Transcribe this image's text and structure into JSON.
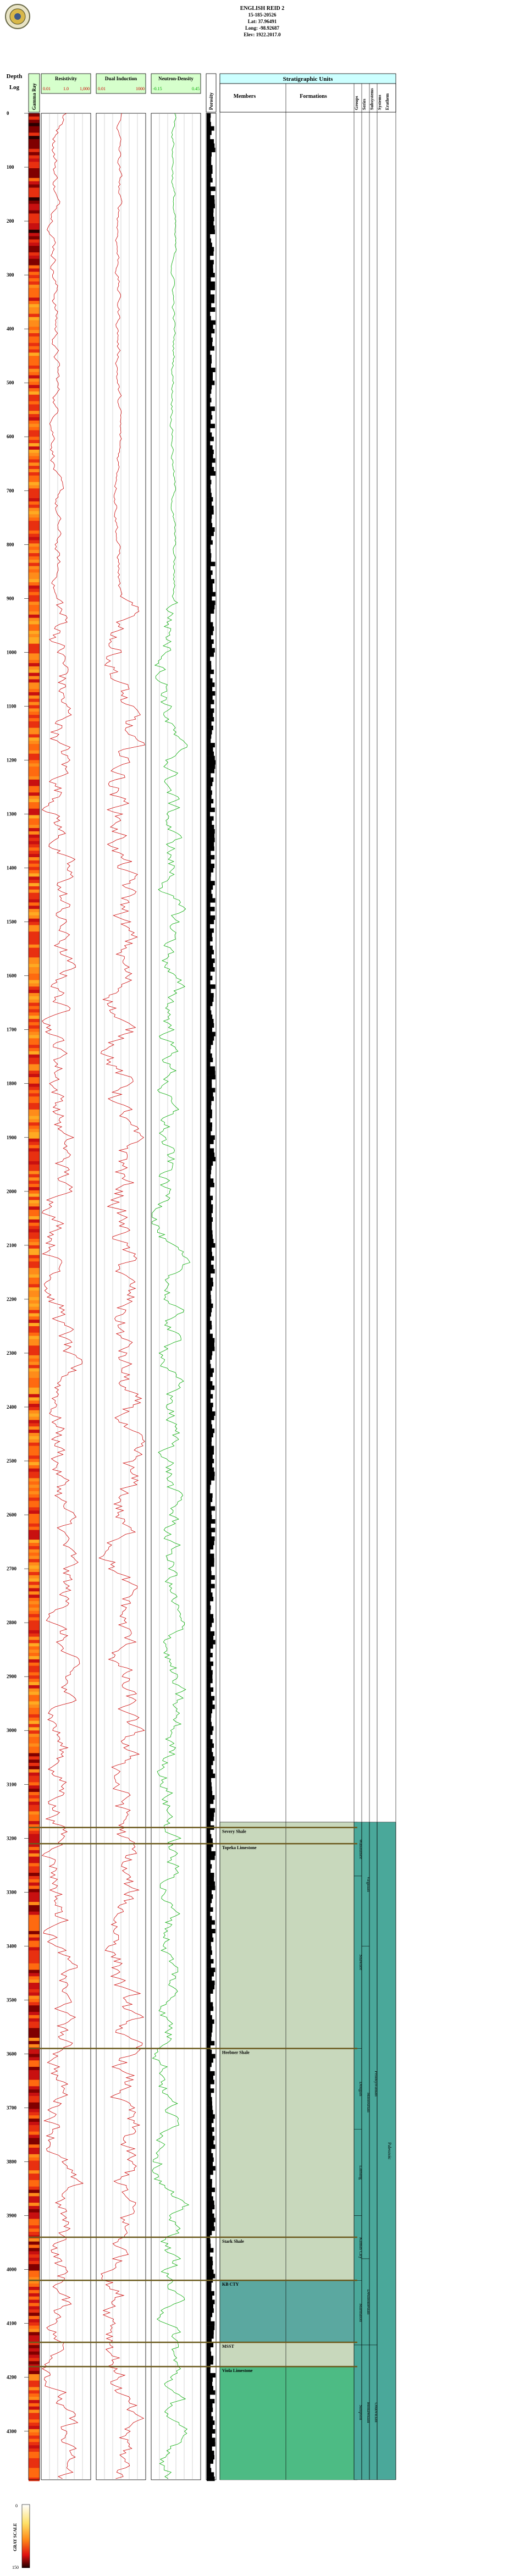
{
  "header": {
    "well_name": "ENGLISH REID 2",
    "api": "15-185-20526",
    "lat": "Lat: 37.96491",
    "long": "Long: -98.92687",
    "elev": "Elev: 1922.2017.0"
  },
  "columns": {
    "depth_title": "Depth",
    "log_title": "Log",
    "gamma_label": "Gamma Ray",
    "gamma_min": "0",
    "gamma_max": "150",
    "resistivity_label": "Resistivity",
    "res_min": "0.01",
    "res_mid": "1.0",
    "res_max": "1,000",
    "res_units": "OHM-M",
    "induction_label": "Dual Induction",
    "ind_min": "0.01",
    "ind_max": "1000",
    "neutron_label": "Neutron-Density",
    "nd_min": "-0.15",
    "nd_max": "0.45",
    "porosity_label": "Porosity",
    "strat_title": "Stratigraphic Units",
    "members_label": "Members",
    "formations_label": "Formations",
    "groups_label": "Groups",
    "series_label": "Series",
    "subsystems_label": "Subsystems",
    "systems_label": "Systems",
    "erathem_label": "Erathem"
  },
  "legend": {
    "title": "GRAY SCALE",
    "min": "0",
    "max": "150"
  },
  "colors": {
    "resistivity": "#cc0000",
    "induction": "#cc0000",
    "neutron": "#00aa00",
    "header_band": "#ccffff",
    "strat_fill": "#c8d8bc",
    "strat_teal": "#5ba8a0",
    "strat_green": "#4dbb84",
    "marker_line": "#6b5a1e"
  },
  "chart_data": {
    "type": "line",
    "title": "ENGLISH REID 2",
    "ylabel": "Depth",
    "depth_ticks": [
      "0",
      "100",
      "200",
      "300",
      "400",
      "500",
      "600",
      "700",
      "800",
      "900",
      "1000",
      "1100",
      "1200",
      "1300",
      "1400",
      "1500",
      "1600",
      "1700",
      "1800",
      "1900",
      "2000",
      "2100",
      "2200",
      "2300",
      "2400",
      "2500",
      "2600",
      "2700",
      "2800",
      "2900",
      "3000",
      "3100",
      "3200",
      "3300",
      "3400",
      "3500",
      "3600",
      "3700",
      "3800",
      "3900",
      "4000",
      "4100",
      "4200",
      "4300"
    ],
    "ylim": [
      0,
      4390
    ],
    "series": [
      {
        "name": "Resistivity",
        "xlim": [
          0.01,
          1000
        ],
        "scale": "log"
      },
      {
        "name": "Dual Induction",
        "xlim": [
          0.01,
          1000
        ],
        "scale": "log"
      },
      {
        "name": "Neutron-Density",
        "xlim": [
          -0.15,
          0.45
        ],
        "scale": "linear"
      }
    ],
    "tops": [
      {
        "depth": 3180,
        "name": "Severy Shale"
      },
      {
        "depth": 3210,
        "name": "Topeka Limestone"
      },
      {
        "depth": 3590,
        "name": "Heebner Shale"
      },
      {
        "depth": 3940,
        "name": "Stark Shale"
      },
      {
        "depth": 4020,
        "name": "KB CTY"
      },
      {
        "depth": 4135,
        "name": "MSST"
      },
      {
        "depth": 4180,
        "name": "Viola Limestone"
      }
    ],
    "strat_groups": [
      {
        "top": 3170,
        "bottom": 3270,
        "label": "Wabaunsee"
      },
      {
        "top": 3270,
        "bottom": 3590,
        "label": "Shawnee"
      },
      {
        "top": 3590,
        "bottom": 3740,
        "label": "Douglas"
      },
      {
        "top": 3740,
        "bottom": 3900,
        "label": "Lansing"
      },
      {
        "top": 3900,
        "bottom": 4020,
        "label": "Kansas City"
      },
      {
        "top": 4020,
        "bottom": 4140,
        "label": "Marmaton"
      },
      {
        "top": 4140,
        "bottom": 4390,
        "label": "Simpson"
      }
    ],
    "strat_series": [
      {
        "top": 3170,
        "bottom": 3400,
        "label": "Virgilian"
      },
      {
        "top": 3400,
        "bottom": 3980,
        "label": "Missourian"
      },
      {
        "top": 3980,
        "bottom": 4140,
        "label": "Desmoinesian"
      },
      {
        "top": 4140,
        "bottom": 4390,
        "label": "Mohawkian"
      }
    ],
    "strat_systems": [
      {
        "top": 3170,
        "bottom": 4140,
        "label": "Pennsylvanian"
      },
      {
        "top": 4140,
        "bottom": 4390,
        "label": "Ordovician"
      }
    ],
    "strat_erathem": [
      {
        "top": 3170,
        "bottom": 4390,
        "label": "Paleozoic"
      }
    ]
  }
}
